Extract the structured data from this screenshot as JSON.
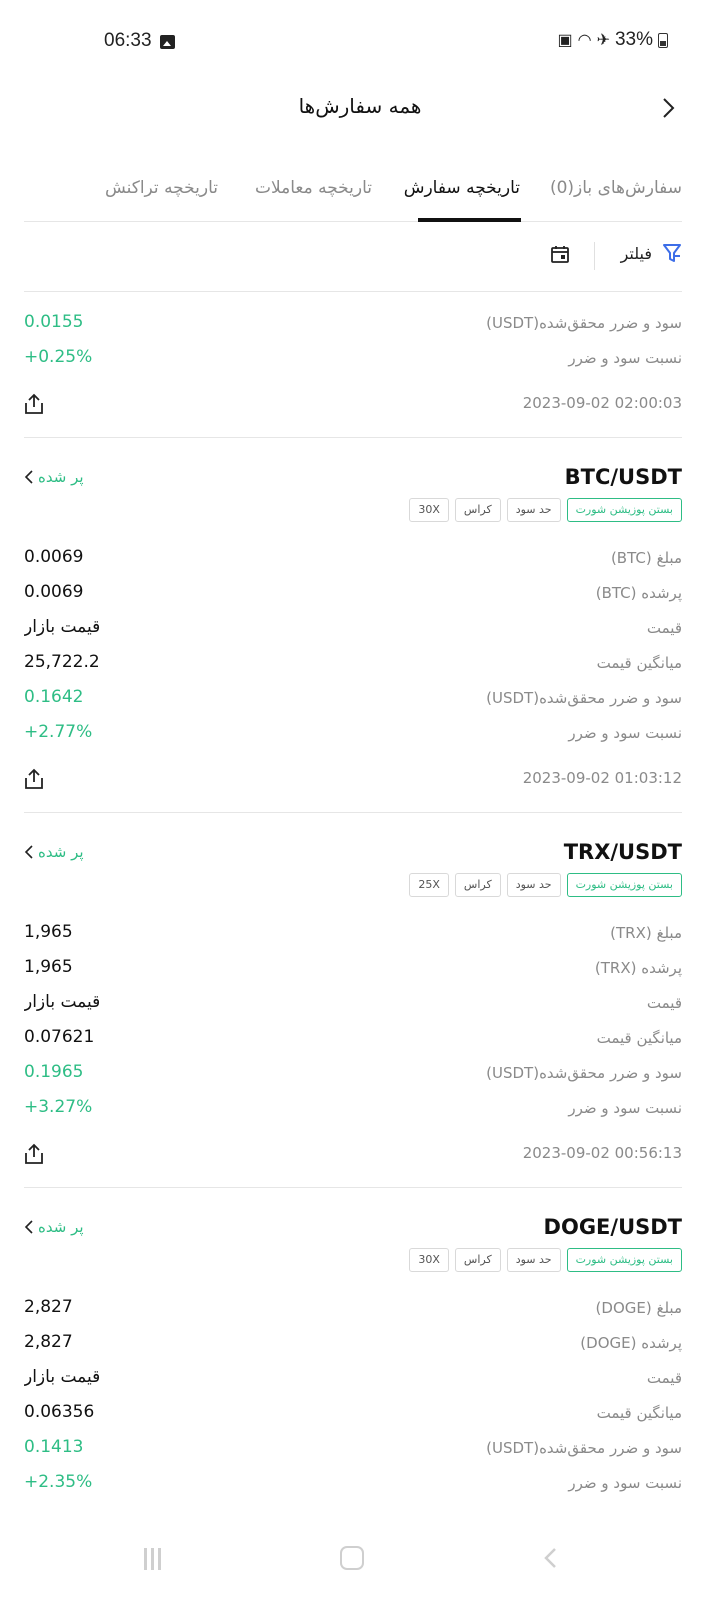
{
  "status_bar": {
    "time": "06:33",
    "battery": "33%"
  },
  "header": {
    "title": "همه سفارش‌ها"
  },
  "tabs": [
    {
      "label": "سفارش‌های باز(0)"
    },
    {
      "label": "تاریخچه سفارش"
    },
    {
      "label": "تاریخچه معاملات"
    },
    {
      "label": "تاریخچه تراکنش"
    }
  ],
  "filter": {
    "label": "فیلتر"
  },
  "partial_card": {
    "rows": [
      {
        "label": "سود و ضرر محقق‌شده(USDT)",
        "value": "0.0155",
        "positive": true
      },
      {
        "label": "نسبت سود و ضرر",
        "value": "+0.25%",
        "positive": true
      }
    ],
    "timestamp": "2023-09-02 02:00:03"
  },
  "orders": [
    {
      "pair": "BTC/USDT",
      "status": "پر شده",
      "tags": [
        "بستن پوزیشن شورت",
        "حد سود",
        "کراس",
        "30X"
      ],
      "rows": [
        {
          "label": "مبلغ (BTC)",
          "value": "0.0069",
          "positive": false
        },
        {
          "label": "پرشده (BTC)",
          "value": "0.0069",
          "positive": false
        },
        {
          "label": "قیمت",
          "value": "قیمت بازار",
          "positive": false
        },
        {
          "label": "میانگین قیمت",
          "value": "25,722.2",
          "positive": false
        },
        {
          "label": "سود و ضرر محقق‌شده(USDT)",
          "value": "0.1642",
          "positive": true
        },
        {
          "label": "نسبت سود و ضرر",
          "value": "+2.77%",
          "positive": true
        }
      ],
      "timestamp": "2023-09-02 01:03:12"
    },
    {
      "pair": "TRX/USDT",
      "status": "پر شده",
      "tags": [
        "بستن پوزیشن شورت",
        "حد سود",
        "کراس",
        "25X"
      ],
      "rows": [
        {
          "label": "مبلغ (TRX)",
          "value": "1,965",
          "positive": false
        },
        {
          "label": "پرشده (TRX)",
          "value": "1,965",
          "positive": false
        },
        {
          "label": "قیمت",
          "value": "قیمت بازار",
          "positive": false
        },
        {
          "label": "میانگین قیمت",
          "value": "0.07621",
          "positive": false
        },
        {
          "label": "سود و ضرر محقق‌شده(USDT)",
          "value": "0.1965",
          "positive": true
        },
        {
          "label": "نسبت سود و ضرر",
          "value": "+3.27%",
          "positive": true
        }
      ],
      "timestamp": "2023-09-02 00:56:13"
    },
    {
      "pair": "DOGE/USDT",
      "status": "پر شده",
      "tags": [
        "بستن پوزیشن شورت",
        "حد سود",
        "کراس",
        "30X"
      ],
      "rows": [
        {
          "label": "مبلغ (DOGE)",
          "value": "2,827",
          "positive": false
        },
        {
          "label": "پرشده (DOGE)",
          "value": "2,827",
          "positive": false
        },
        {
          "label": "قیمت",
          "value": "قیمت بازار",
          "positive": false
        },
        {
          "label": "میانگین قیمت",
          "value": "0.06356",
          "positive": false
        },
        {
          "label": "سود و ضرر محقق‌شده(USDT)",
          "value": "0.1413",
          "positive": true
        },
        {
          "label": "نسبت سود و ضرر",
          "value": "+2.35%",
          "positive": true
        }
      ],
      "timestamp": ""
    }
  ],
  "colors": {
    "positive": "#2ebd85",
    "accent": "#3d6ee8"
  }
}
